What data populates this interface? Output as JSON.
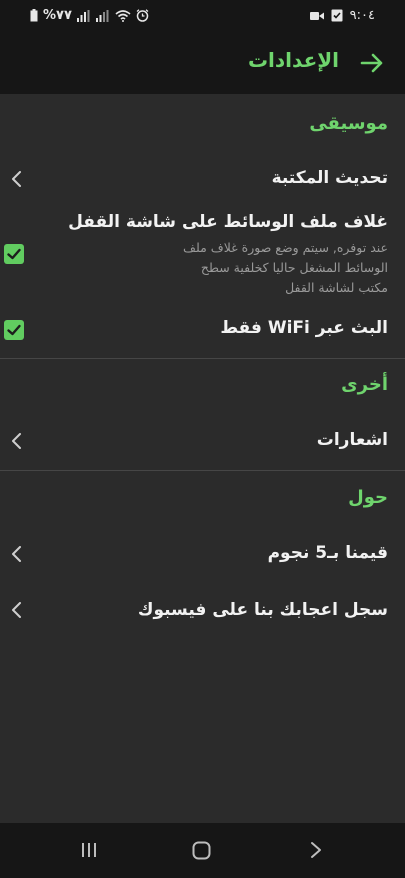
{
  "status_bar": {
    "battery_text": "%٧٧",
    "time": "٩:٠٤",
    "left_icons": [
      "battery-icon",
      "signal-icon",
      "signal-icon",
      "wifi-icon",
      "alarm-icon"
    ],
    "right_icons": [
      "video-icon",
      "checklist-icon"
    ]
  },
  "app_bar": {
    "title": "الإعدادات",
    "back_icon": "arrow-right-icon"
  },
  "sections": {
    "music": {
      "header": "موسيقى",
      "library_update": "تحديث المكتبة",
      "lockscreen_cover_title": "غلاف ملف الوسائط على شاشة القفل",
      "lockscreen_cover_desc": "عند توفره, سيتم وضع صورة غلاف ملف الوسائط المشغل حاليا كخلفية سطح مكتب لشاشة القفل",
      "lockscreen_cover_checked": true,
      "wifi_only": "البث عبر WiFi فقط",
      "wifi_only_checked": true
    },
    "other": {
      "header": "أخرى",
      "notifications": "اشعارات"
    },
    "about": {
      "header": "حول",
      "rate": "قيمنا بـ5 نجوم",
      "facebook": "سجل اعجابك بنا على فيسبوك"
    }
  },
  "nav_bar": {
    "recents_icon": "recents-icon",
    "home_icon": "home-icon",
    "back_icon": "back-icon"
  },
  "colors": {
    "accent": "#6fd46d",
    "background": "#2b2b2b",
    "bar": "#161616",
    "checkbox": "#61cc60"
  }
}
